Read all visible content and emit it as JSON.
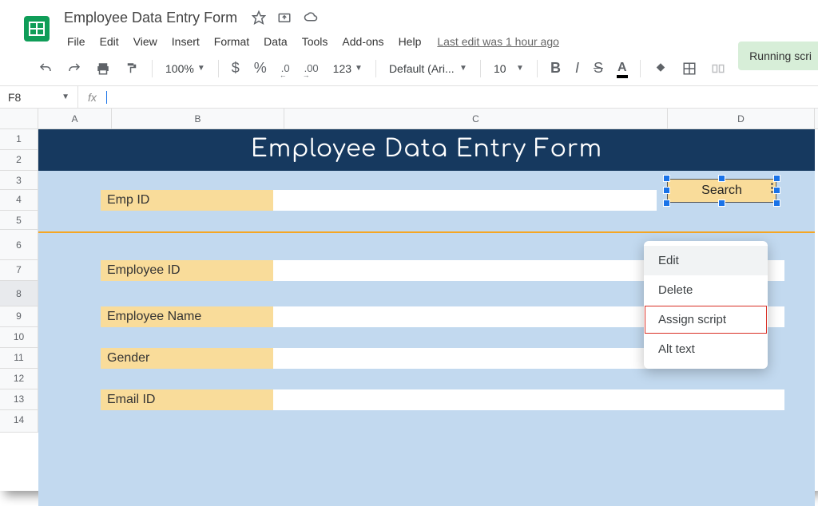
{
  "doc": {
    "title": "Employee Data Entry Form"
  },
  "menu": {
    "file": "File",
    "edit": "Edit",
    "view": "View",
    "insert": "Insert",
    "format": "Format",
    "data": "Data",
    "tools": "Tools",
    "addons": "Add-ons",
    "help": "Help",
    "last_edit": "Last edit was 1 hour ago"
  },
  "toolbar": {
    "zoom": "100%",
    "currency": "$",
    "percent": "%",
    "dec_dec": ".0",
    "dec_inc": ".00",
    "more_fmt": "123",
    "font": "Default (Ari...",
    "font_size": "10",
    "bold": "B",
    "italic": "I",
    "strike": "S",
    "text_color": "A"
  },
  "namebox": {
    "cell": "F8",
    "fx": "fx"
  },
  "columns": {
    "A": "A",
    "B": "B",
    "C": "C",
    "D": "D"
  },
  "rows": [
    "1",
    "2",
    "3",
    "4",
    "5",
    "6",
    "7",
    "8",
    "9",
    "10",
    "11",
    "12",
    "13",
    "14"
  ],
  "form": {
    "title": "Employee Data Entry Form",
    "emp_id_label": "Emp ID",
    "employee_id_label": "Employee ID",
    "employee_name_label": "Employee Name",
    "gender_label": "Gender",
    "email_id_label": "Email ID",
    "search_btn": "Search"
  },
  "ctx": {
    "edit": "Edit",
    "delete": "Delete",
    "assign_script": "Assign script",
    "alt_text": "Alt text"
  },
  "toast": {
    "running": "Running scri"
  }
}
